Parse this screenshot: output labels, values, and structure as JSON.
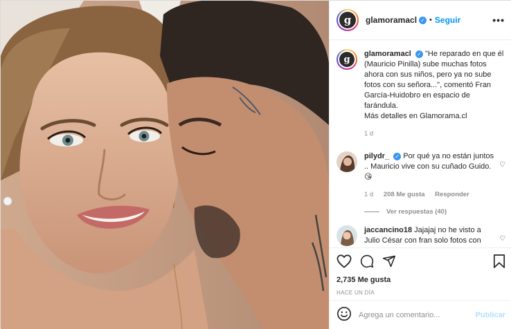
{
  "header": {
    "username": "glamoramacl",
    "separator": "•",
    "follow_label": "Seguir",
    "more_label": "•••"
  },
  "caption": {
    "username": "glamoramacl",
    "text": "\"He reparado en que él (Mauricio Pinilla) sube muchas fotos ahora con sus niños, pero ya no sube fotos con su señora...\", comentó Fran García-Huidobro en espacio de farándula.",
    "text2": "Más detalles en Glamorama.cl",
    "age": "1 d"
  },
  "comments": [
    {
      "username": "pilydr_",
      "text": "Por qué ya no están juntos .. Mauricio vive con su cuñado Guido. 😘",
      "age": "1 d",
      "likes": "208 Me gusta",
      "reply_label": "Responder",
      "view_replies": "Ver respuestas (40)"
    },
    {
      "username": "jaccancino18",
      "text": "Jajajaj no he visto a Julio César con fran solo fotos con"
    }
  ],
  "post": {
    "likes": "2,735 Me gusta",
    "time_ago": "HACE UN DÍA"
  },
  "composer": {
    "placeholder": "Agrega un comentario...",
    "publish_label": "Publicar"
  },
  "colors": {
    "link_blue": "#0095f6",
    "verified_blue": "#3897f0",
    "muted": "#8e8e8e",
    "publish_disabled": "#b2dffc"
  },
  "icons": [
    "heart-icon",
    "comment-icon",
    "share-icon",
    "bookmark-icon",
    "emoji-icon",
    "verified-icon"
  ]
}
